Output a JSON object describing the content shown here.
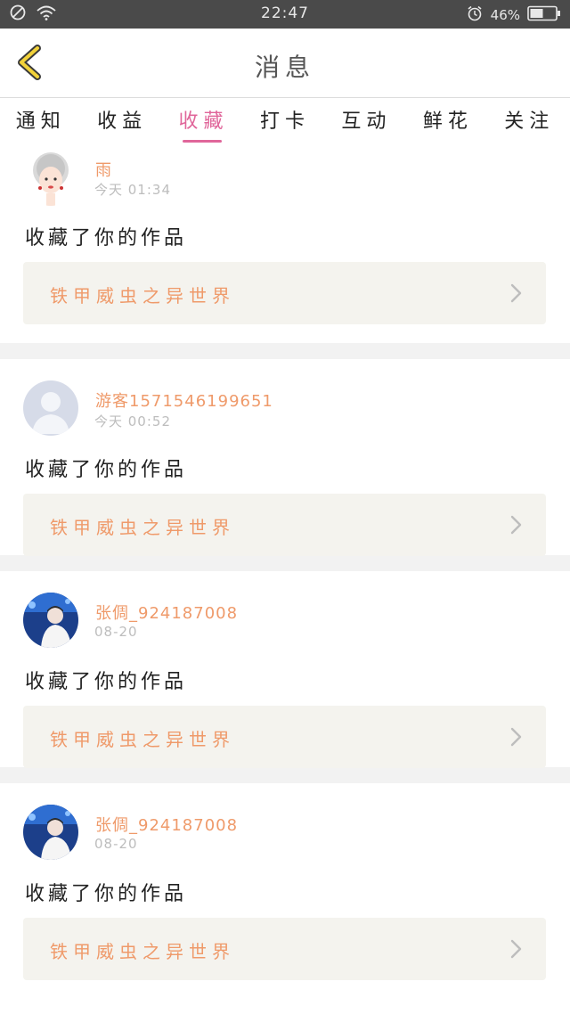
{
  "status_bar": {
    "time": "22:47",
    "battery": "46%"
  },
  "header": {
    "title": "消息"
  },
  "tabs": [
    {
      "label": "通知"
    },
    {
      "label": "收益"
    },
    {
      "label": "收藏",
      "active": true
    },
    {
      "label": "打卡"
    },
    {
      "label": "互动"
    },
    {
      "label": "鲜花"
    },
    {
      "label": "关注"
    }
  ],
  "items": [
    {
      "user": "雨",
      "time": "今天 01:34",
      "action": "收藏了你的作品",
      "work": "铁甲威虫之异世界"
    },
    {
      "user": "游客1571546199651",
      "time": "今天 00:52",
      "action": "收藏了你的作品",
      "work": "铁甲威虫之异世界"
    },
    {
      "user": "张倜_924187008",
      "time": "08-20",
      "action": "收藏了你的作品",
      "work": "铁甲威虫之异世界"
    },
    {
      "user": "张倜_924187008",
      "time": "08-20",
      "action": "收藏了你的作品",
      "work": "铁甲威虫之异世界"
    }
  ],
  "colors": {
    "accent": "#e0669a",
    "orange": "#ef9a6a",
    "status_bar": "#4a4a4a"
  }
}
